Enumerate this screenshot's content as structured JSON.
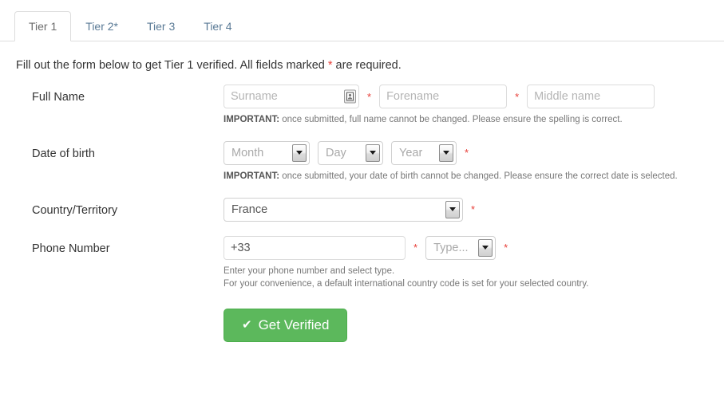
{
  "tabs": [
    {
      "label": "Tier 1",
      "active": true
    },
    {
      "label": "Tier 2*",
      "active": false
    },
    {
      "label": "Tier 3",
      "active": false
    },
    {
      "label": "Tier 4",
      "active": false
    }
  ],
  "intro": {
    "before_star": "Fill out the form below to get Tier 1 verified. All fields marked ",
    "star": "*",
    "after_star": " are required."
  },
  "required_marker": "*",
  "form": {
    "full_name": {
      "label": "Full Name",
      "surname_placeholder": "Surname",
      "surname_value": "",
      "surname_icon": "contact-card-icon",
      "forename_placeholder": "Forename",
      "forename_value": "",
      "middle_placeholder": "Middle name",
      "middle_value": "",
      "help_bold": "IMPORTANT:",
      "help_text": " once submitted, full name cannot be changed. Please ensure the spelling is correct."
    },
    "date_of_birth": {
      "label": "Date of birth",
      "month_value": "Month",
      "day_value": "Day",
      "year_value": "Year",
      "help_bold": "IMPORTANT:",
      "help_text": " once submitted, your date of birth cannot be changed. Please ensure the correct date is selected."
    },
    "country": {
      "label": "Country/Territory",
      "value": "France"
    },
    "phone": {
      "label": "Phone Number",
      "number_value": "+33",
      "type_value": "Type...",
      "help_line_1": "Enter your phone number and select type.",
      "help_line_2": "For your convenience, a default international country code is set for your selected country."
    }
  },
  "submit": {
    "label": "Get Verified",
    "icon": "check-icon",
    "color": "#5cb85c"
  }
}
